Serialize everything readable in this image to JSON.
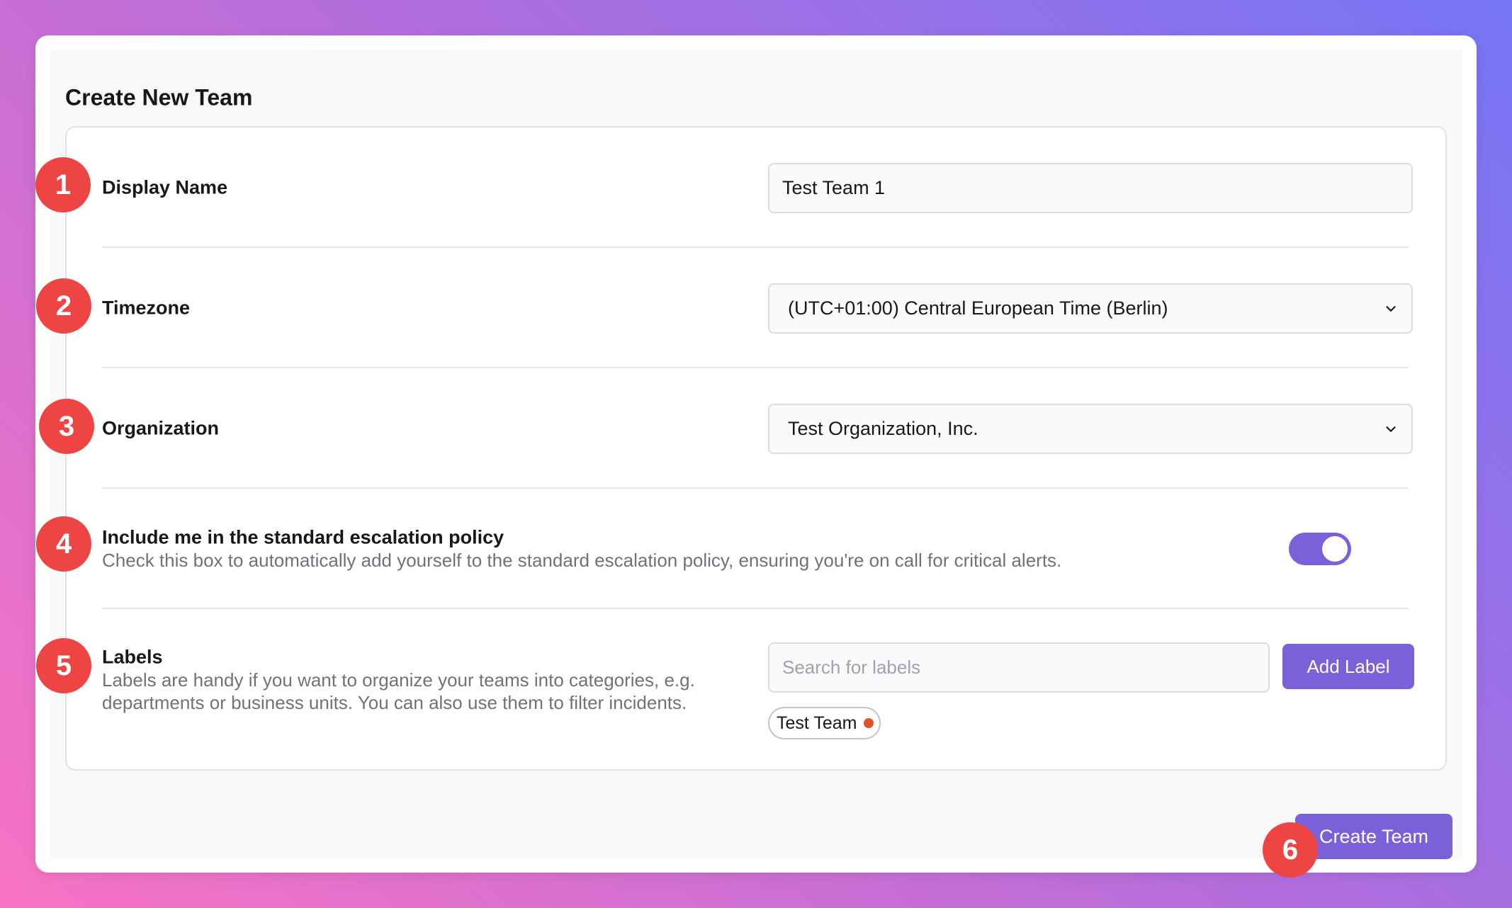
{
  "page": {
    "title": "Create New Team"
  },
  "form": {
    "display_name": {
      "label": "Display Name",
      "value": "Test Team 1"
    },
    "timezone": {
      "label": "Timezone",
      "value": "(UTC+01:00) Central European Time (Berlin)"
    },
    "organization": {
      "label": "Organization",
      "value": "Test Organization, Inc."
    },
    "escalation": {
      "label": "Include me in the standard escalation policy",
      "description": "Check this box to automatically add yourself to the standard escalation policy, ensuring you're on call for critical alerts.",
      "enabled": true
    },
    "labels": {
      "label": "Labels",
      "description_line1": "Labels are handy if you want to organize your teams into categories, e.g.",
      "description_line2": "departments or business units. You can also use them to filter incidents.",
      "search_placeholder": "Search for labels",
      "add_button": "Add Label",
      "chips": [
        {
          "text": "Test Team",
          "color": "#e0502a"
        }
      ]
    }
  },
  "footer": {
    "create_button": "Create Team"
  },
  "badges": [
    "1",
    "2",
    "3",
    "4",
    "5",
    "6"
  ],
  "colors": {
    "accent": "#7b61d9",
    "badge": "#ef4444"
  }
}
